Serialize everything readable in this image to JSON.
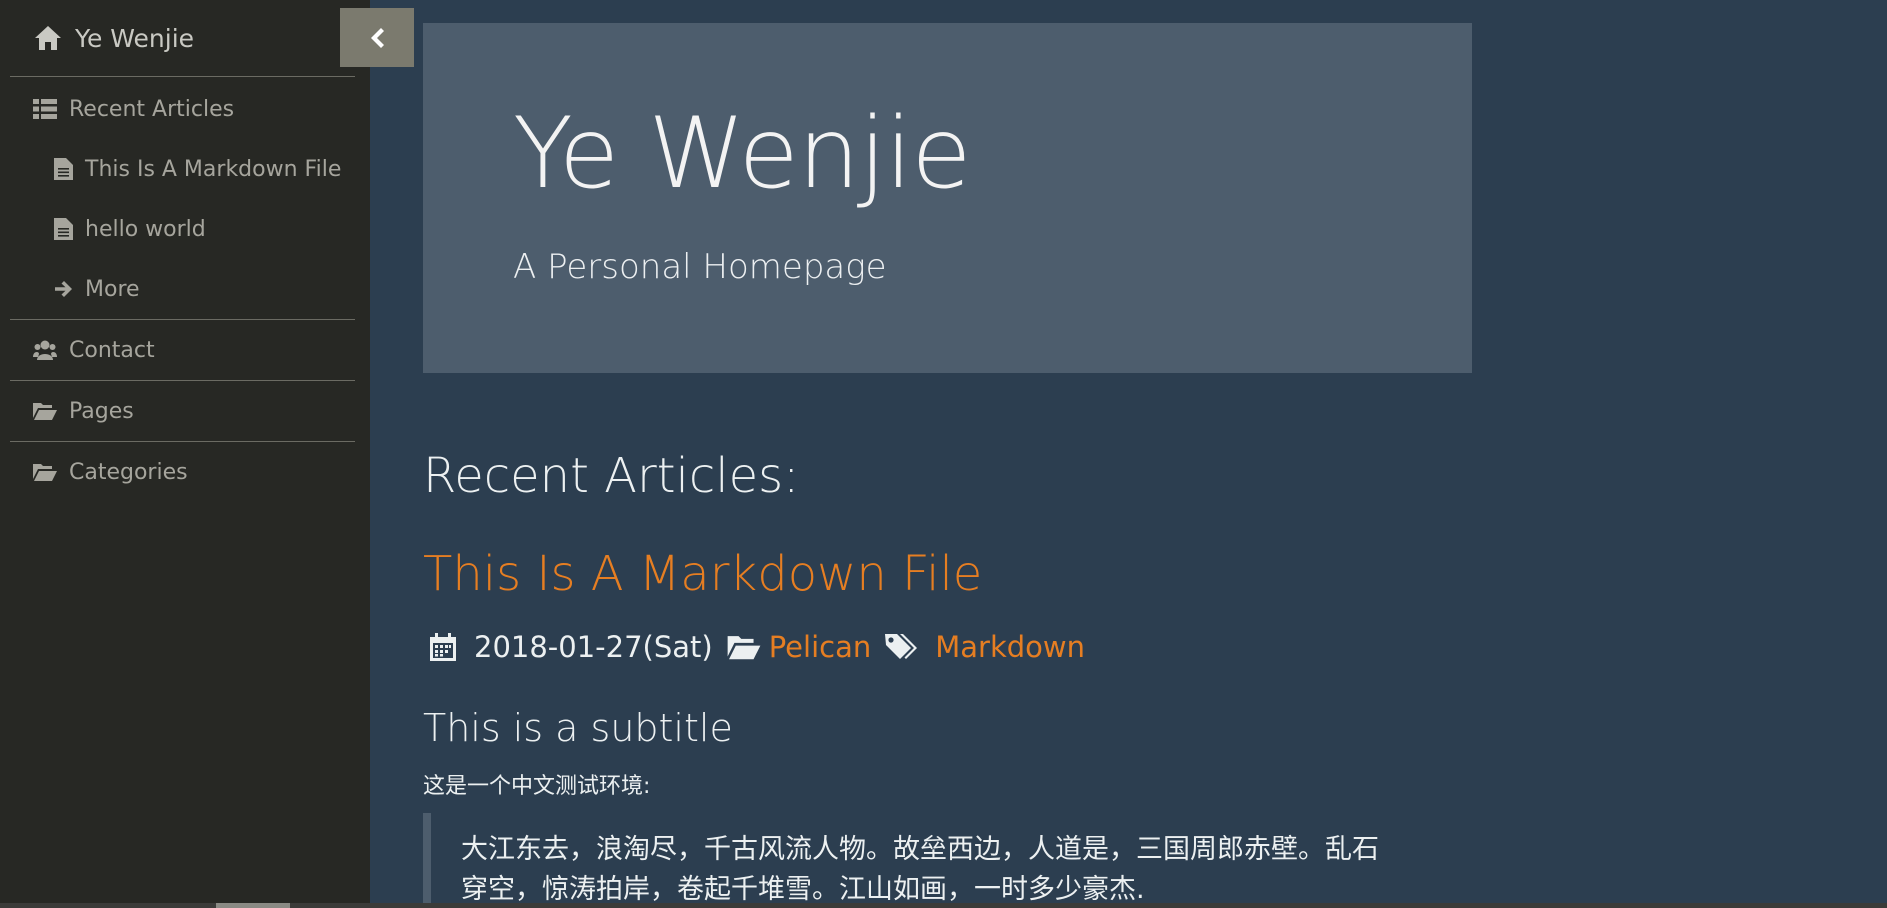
{
  "sidebar": {
    "home_label": "Ye Wenjie",
    "recent_label": "Recent Articles",
    "recent_items": [
      "This Is A Markdown File",
      "hello world"
    ],
    "more_label": "More",
    "contact_label": "Contact",
    "pages_label": "Pages",
    "categories_label": "Categories"
  },
  "hero": {
    "title": "Ye Wenjie",
    "subtitle": "A Personal Homepage"
  },
  "main": {
    "section_title": "Recent Articles:",
    "article": {
      "title": "This Is A Markdown File",
      "date": "2018-01-27(Sat)",
      "category": "Pelican",
      "tag": "Markdown",
      "subtitle": "This is a subtitle",
      "paragraph": "这是一个中文测试环境:",
      "quote_line1": "大江东去，浪淘尽，千古风流人物。故垒西边，人道是，三国周郎赤壁。乱石",
      "quote_line2": "穿空，惊涛拍岸，卷起千堆雪。江山如画，一时多少豪杰."
    }
  },
  "colors": {
    "background": "#2c3e50",
    "sidebar": "#272824",
    "hero": "#4d5d6d",
    "accent": "#e67e22"
  },
  "icons": {
    "home": "home-icon",
    "list": "list-icon",
    "file": "file-icon",
    "arrow": "arrow-right-icon",
    "users": "users-icon",
    "folder": "folder-open-icon",
    "calendar": "calendar-icon",
    "tags": "tags-icon",
    "chevron": "chevron-left-icon"
  }
}
